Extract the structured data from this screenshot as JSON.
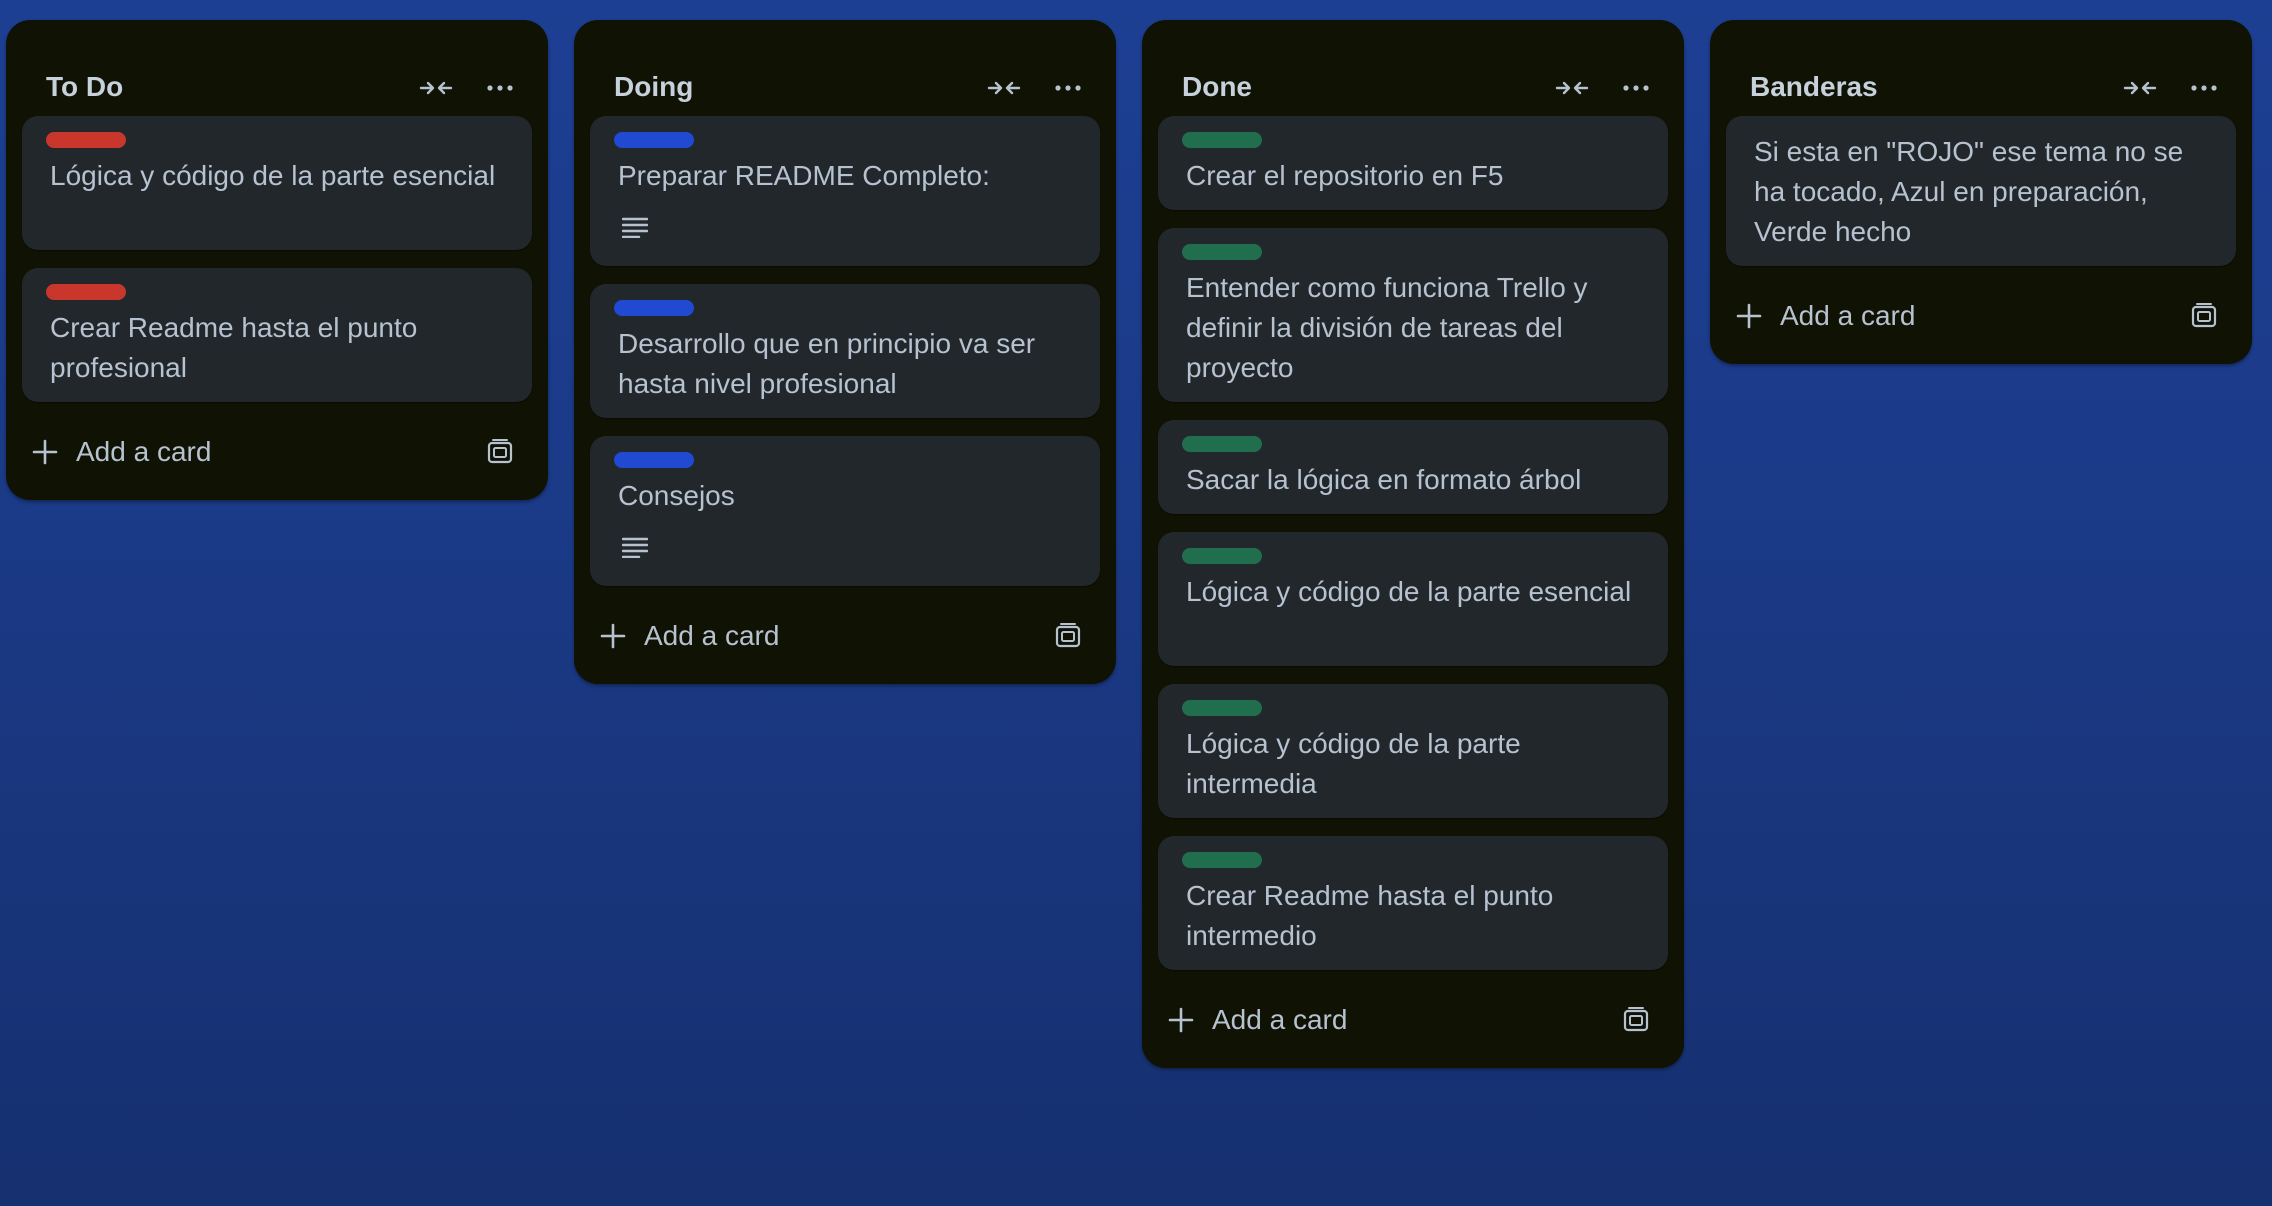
{
  "colors": {
    "label_red": "#c9372c",
    "label_blue": "#1f4ad1",
    "label_green": "#216e4e"
  },
  "lists": [
    {
      "title": "To Do",
      "cards": [
        {
          "label_color": "red",
          "title": "Lógica y código de la parte esencial"
        },
        {
          "label_color": "red",
          "title": "Crear Readme hasta el punto profesional"
        }
      ],
      "add_label": "Add a card"
    },
    {
      "title": "Doing",
      "cards": [
        {
          "label_color": "blue",
          "title": "Preparar README Completo:",
          "has_description": true
        },
        {
          "label_color": "blue",
          "title": "Desarrollo que en principio va ser hasta nivel profesional"
        },
        {
          "label_color": "blue",
          "title": "Consejos",
          "has_description": true
        }
      ],
      "add_label": "Add a card"
    },
    {
      "title": "Done",
      "cards": [
        {
          "label_color": "green",
          "title": "Crear el repositorio en F5"
        },
        {
          "label_color": "green",
          "title": "Entender como funciona Trello y definir la división de tareas del proyecto"
        },
        {
          "label_color": "green",
          "title": "Sacar la lógica en formato árbol"
        },
        {
          "label_color": "green",
          "title": "Lógica y código de la parte esencial"
        },
        {
          "label_color": "green",
          "title": "Lógica y código de la parte intermedia"
        },
        {
          "label_color": "green",
          "title": "Crear Readme hasta el punto intermedio"
        }
      ],
      "add_label": "Add a card"
    },
    {
      "title": "Banderas",
      "cards": [
        {
          "label_color": null,
          "title": "Si esta en \"ROJO\" ese tema no se ha tocado, Azul en preparación, Verde hecho"
        }
      ],
      "add_label": "Add a card"
    }
  ],
  "icons": {
    "collapse": "collapse-arrows-icon",
    "menu": "ellipsis-icon",
    "add": "plus-icon",
    "template": "card-template-icon",
    "description": "description-lines-icon"
  }
}
